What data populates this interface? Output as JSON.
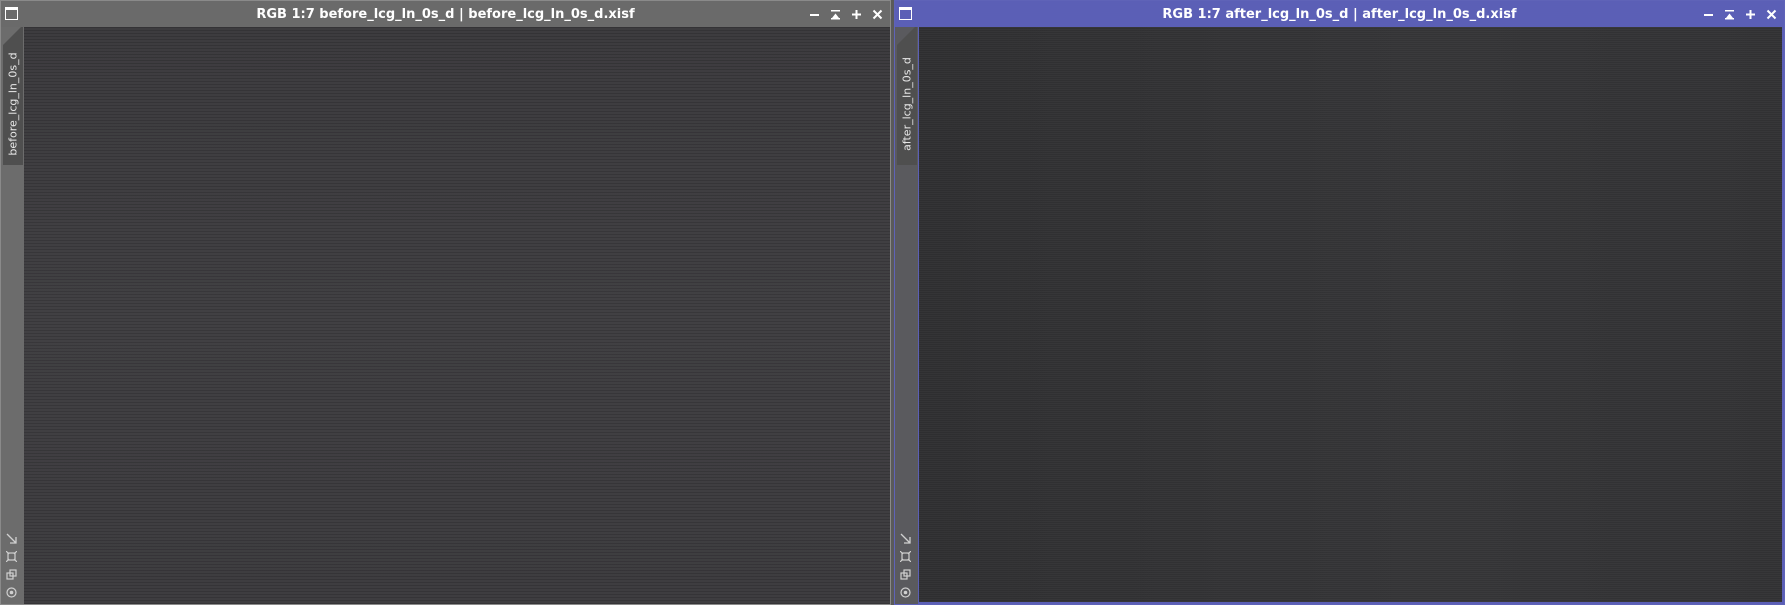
{
  "windows": [
    {
      "id": "before",
      "title": "RGB 1:7 before_lcg_ln_0s_d | before_lcg_ln_0s_d.xisf",
      "tab_label": "before_lcg_ln_0s_d",
      "active": false
    },
    {
      "id": "after",
      "title": "RGB 1:7 after_lcg_ln_0s_d | after_lcg_ln_0s_d.xisf",
      "tab_label": "after_lcg_ln_0s_d",
      "active": true
    }
  ],
  "colors": {
    "inactive_titlebar": "#6a6a6a",
    "active_titlebar": "#5b5fb6",
    "before_image": "#3c3b3e",
    "after_image": "#333335"
  },
  "icons": {
    "title_left": "window-menu-icon",
    "minimize": "minimize-icon",
    "shade": "shade-icon",
    "maximize": "maximize-icon",
    "close": "close-icon",
    "side_tools": [
      "expand-arrow-icon",
      "fit-view-icon",
      "clone-view-icon",
      "target-icon"
    ]
  }
}
